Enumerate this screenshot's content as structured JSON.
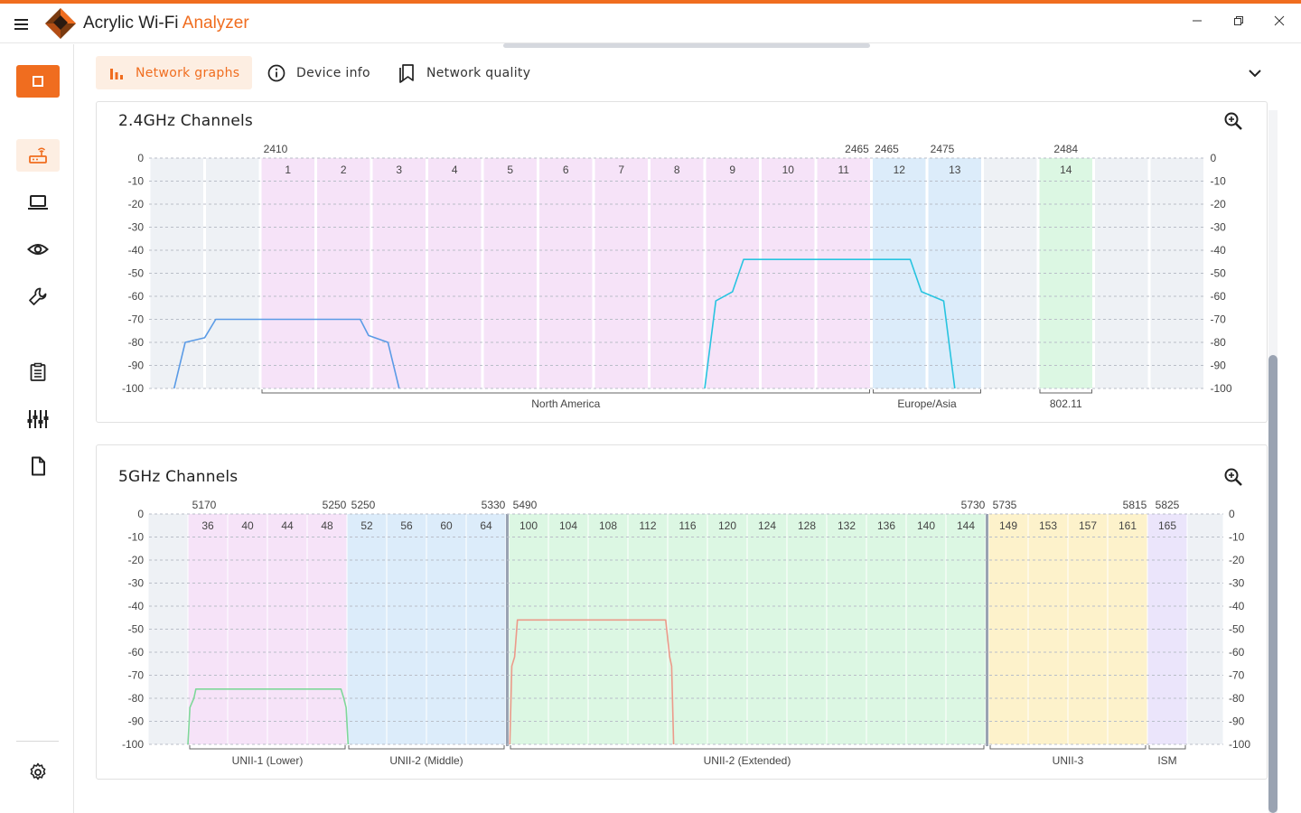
{
  "app": {
    "title_main": "Acrylic Wi-Fi ",
    "title_accent": "Analyzer",
    "window_buttons": {
      "minimize": "—",
      "restore": "❐",
      "close": "✕"
    }
  },
  "sidebar": {
    "items": [
      {
        "name": "stop",
        "icon": "stop-square-icon"
      },
      {
        "name": "networks",
        "icon": "router-icon"
      },
      {
        "name": "devices",
        "icon": "laptop-icon"
      },
      {
        "name": "monitor",
        "icon": "eye-icon"
      },
      {
        "name": "tools",
        "icon": "wrench-icon"
      },
      {
        "name": "reports",
        "icon": "clipboard-icon"
      },
      {
        "name": "equalizer",
        "icon": "sliders-icon"
      },
      {
        "name": "files",
        "icon": "document-icon"
      },
      {
        "name": "settings",
        "icon": "gear-icon"
      }
    ]
  },
  "tabs": [
    {
      "label": "Network graphs",
      "icon": "bar-chart-icon",
      "active": true
    },
    {
      "label": "Device info",
      "icon": "info-icon",
      "active": false
    },
    {
      "label": "Network quality",
      "icon": "bookmark-icon",
      "active": false
    }
  ],
  "colors": {
    "accent": "#f06d1f",
    "accent_light": "#fdeee2",
    "band_pink": "#f6e3f8",
    "band_blue": "#dcecfa",
    "band_green": "#dcf7e3",
    "band_yellow": "#fdf2cb",
    "band_purple": "#ebe5fb",
    "band_gray": "#eef1f5"
  },
  "panel24": {
    "title": "2.4GHz Channels"
  },
  "panel5": {
    "title": "5GHz Channels"
  },
  "chart_data": [
    {
      "type": "line",
      "title": "2.4GHz Channels",
      "y_ticks": [
        "0",
        "-10",
        "-20",
        "-30",
        "-40",
        "-50",
        "-60",
        "-70",
        "-80",
        "-90",
        "-100"
      ],
      "ylim": [
        -100,
        0
      ],
      "grid": true,
      "slots": [
        {
          "label": "",
          "color": "band_gray"
        },
        {
          "label": "",
          "color": "band_gray"
        },
        {
          "label": "1",
          "color": "band_pink"
        },
        {
          "label": "2",
          "color": "band_pink"
        },
        {
          "label": "3",
          "color": "band_pink"
        },
        {
          "label": "4",
          "color": "band_pink"
        },
        {
          "label": "5",
          "color": "band_pink"
        },
        {
          "label": "6",
          "color": "band_pink"
        },
        {
          "label": "7",
          "color": "band_pink"
        },
        {
          "label": "8",
          "color": "band_pink"
        },
        {
          "label": "9",
          "color": "band_pink"
        },
        {
          "label": "10",
          "color": "band_pink"
        },
        {
          "label": "11",
          "color": "band_pink"
        },
        {
          "label": "12",
          "color": "band_blue"
        },
        {
          "label": "13",
          "color": "band_blue"
        },
        {
          "label": "",
          "color": "band_gray"
        },
        {
          "label": "14",
          "color": "band_green"
        },
        {
          "label": "",
          "color": "band_gray"
        },
        {
          "label": "",
          "color": "band_gray"
        }
      ],
      "freq_labels": [
        {
          "text": "2410",
          "slot": 2,
          "side": "left"
        },
        {
          "text": "2465",
          "slot": 12,
          "side": "right"
        },
        {
          "text": "2465",
          "slot": 13,
          "side": "left"
        },
        {
          "text": "2475",
          "slot": 14,
          "side": "left"
        },
        {
          "text": "2484",
          "slot": 16,
          "side": "center"
        }
      ],
      "regions": [
        {
          "label": "North America",
          "from": 2,
          "to": 12
        },
        {
          "label": "Europe/Asia",
          "from": 13,
          "to": 14
        },
        {
          "label": "802.11",
          "from": 16,
          "to": 16
        }
      ],
      "series": [
        {
          "color": "#5b9be6",
          "points": [
            [
              0.45,
              -100
            ],
            [
              0.65,
              -80
            ],
            [
              1.0,
              -78
            ],
            [
              1.2,
              -70
            ],
            [
              3.8,
              -70
            ],
            [
              3.95,
              -77
            ],
            [
              4.3,
              -80
            ],
            [
              4.5,
              -100
            ]
          ]
        },
        {
          "color": "#28c4e0",
          "points": [
            [
              10.0,
              -100
            ],
            [
              10.2,
              -62
            ],
            [
              10.5,
              -58
            ],
            [
              10.7,
              -44
            ],
            [
              13.7,
              -44
            ],
            [
              13.9,
              -58
            ],
            [
              14.3,
              -62
            ],
            [
              14.5,
              -100
            ]
          ]
        }
      ]
    },
    {
      "type": "line",
      "title": "5GHz Channels",
      "y_ticks": [
        "0",
        "-10",
        "-20",
        "-30",
        "-40",
        "-50",
        "-60",
        "-70",
        "-80",
        "-90",
        "-100"
      ],
      "ylim": [
        -100,
        0
      ],
      "grid": true,
      "slots": [
        {
          "label": "",
          "color": "band_gray",
          "w": 44
        },
        {
          "label": "36",
          "color": "band_pink",
          "w": 44
        },
        {
          "label": "40",
          "color": "band_pink",
          "w": 44
        },
        {
          "label": "44",
          "color": "band_pink",
          "w": 44
        },
        {
          "label": "48",
          "color": "band_pink",
          "w": 44
        },
        {
          "label": "52",
          "color": "band_blue",
          "w": 44
        },
        {
          "label": "56",
          "color": "band_blue",
          "w": 44
        },
        {
          "label": "60",
          "color": "band_blue",
          "w": 44
        },
        {
          "label": "64",
          "color": "band_blue",
          "w": 44,
          "sep": true
        },
        {
          "label": "100",
          "color": "band_green",
          "w": 44
        },
        {
          "label": "104",
          "color": "band_green",
          "w": 44
        },
        {
          "label": "108",
          "color": "band_green",
          "w": 44
        },
        {
          "label": "112",
          "color": "band_green",
          "w": 44
        },
        {
          "label": "116",
          "color": "band_green",
          "w": 44
        },
        {
          "label": "120",
          "color": "band_green",
          "w": 44
        },
        {
          "label": "124",
          "color": "band_green",
          "w": 44
        },
        {
          "label": "128",
          "color": "band_green",
          "w": 44
        },
        {
          "label": "132",
          "color": "band_green",
          "w": 44
        },
        {
          "label": "136",
          "color": "band_green",
          "w": 44
        },
        {
          "label": "140",
          "color": "band_green",
          "w": 44
        },
        {
          "label": "144",
          "color": "band_green",
          "w": 44,
          "sep": true
        },
        {
          "label": "149",
          "color": "band_yellow",
          "w": 44
        },
        {
          "label": "153",
          "color": "band_yellow",
          "w": 44
        },
        {
          "label": "157",
          "color": "band_yellow",
          "w": 44
        },
        {
          "label": "161",
          "color": "band_yellow",
          "w": 44
        },
        {
          "label": "165",
          "color": "band_purple",
          "w": 44
        },
        {
          "label": "",
          "color": "band_gray",
          "w": 40
        }
      ],
      "freq_labels": [
        {
          "text": "5170",
          "slot": 1,
          "side": "left"
        },
        {
          "text": "5250",
          "slot": 4,
          "side": "right"
        },
        {
          "text": "5250",
          "slot": 5,
          "side": "left"
        },
        {
          "text": "5330",
          "slot": 8,
          "side": "right"
        },
        {
          "text": "5490",
          "slot": 9,
          "side": "left"
        },
        {
          "text": "5730",
          "slot": 20,
          "side": "right"
        },
        {
          "text": "5735",
          "slot": 21,
          "side": "left"
        },
        {
          "text": "5815",
          "slot": 24,
          "side": "right"
        },
        {
          "text": "5825",
          "slot": 25,
          "side": "center"
        }
      ],
      "regions": [
        {
          "label": "UNII-1 (Lower)",
          "from": 1,
          "to": 4
        },
        {
          "label": "UNII-2 (Middle)",
          "from": 5,
          "to": 8
        },
        {
          "label": "UNII-2 (Extended)",
          "from": 9,
          "to": 20
        },
        {
          "label": "UNII-3",
          "from": 21,
          "to": 24
        },
        {
          "label": "ISM",
          "from": 25,
          "to": 25
        }
      ],
      "series": [
        {
          "color": "#7fd89a",
          "points": [
            [
              1.0,
              -100
            ],
            [
              1.05,
              -84
            ],
            [
              1.15,
              -80
            ],
            [
              1.2,
              -76
            ],
            [
              4.85,
              -76
            ],
            [
              4.92,
              -80
            ],
            [
              4.98,
              -84
            ],
            [
              5.03,
              -100
            ]
          ]
        },
        {
          "color": "#ec9a8a",
          "points": [
            [
              9.03,
              -100
            ],
            [
              9.08,
              -66
            ],
            [
              9.15,
              -62
            ],
            [
              9.22,
              -46
            ],
            [
              12.95,
              -46
            ],
            [
              13.05,
              -62
            ],
            [
              13.1,
              -66
            ],
            [
              13.15,
              -100
            ]
          ]
        }
      ]
    }
  ]
}
